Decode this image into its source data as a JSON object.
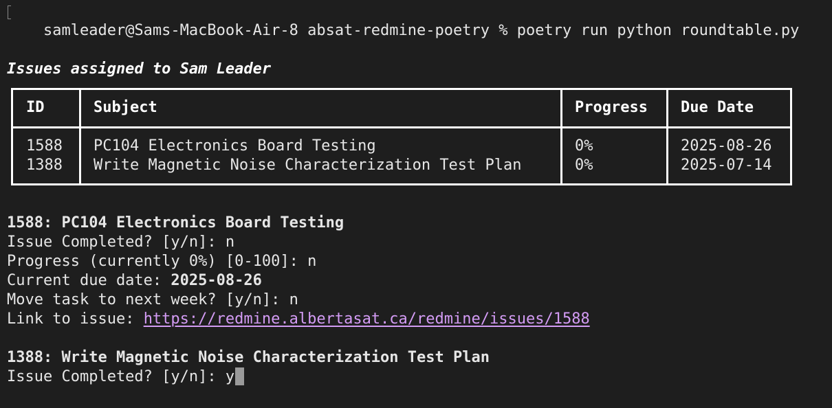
{
  "terminal": {
    "prompt": "samleader@Sams-MacBook-Air-8 absat-redmine-poetry % poetry run python roundtable.py",
    "title": "Issues assigned to Sam Leader"
  },
  "table": {
    "headers": {
      "id": "ID",
      "subject": "Subject",
      "progress": "Progress",
      "due": "Due Date"
    },
    "rows": [
      {
        "id": "1588",
        "subject": "PC104 Electronics Board Testing",
        "progress": "0%",
        "due": "2025-08-26"
      },
      {
        "id": "1388",
        "subject": "Write Magnetic Noise Characterization Test Plan",
        "progress": "0%",
        "due": "2025-07-14"
      }
    ]
  },
  "issue1": {
    "heading": "1588: PC104 Electronics Board Testing",
    "completed_q": "Issue Completed? [y/n]: n",
    "progress_q": "Progress (currently 0%) [0-100]: n",
    "due_label": "Current due date: ",
    "due_value": "2025-08-26",
    "move_q": "Move task to next week? [y/n]: n",
    "link_label": "Link to issue: ",
    "link_url": "https://redmine.albertasat.ca/redmine/issues/1588"
  },
  "issue2": {
    "heading": "1388: Write Magnetic Noise Characterization Test Plan",
    "completed_prompt": "Issue Completed? [y/n]: ",
    "completed_input": "y"
  }
}
